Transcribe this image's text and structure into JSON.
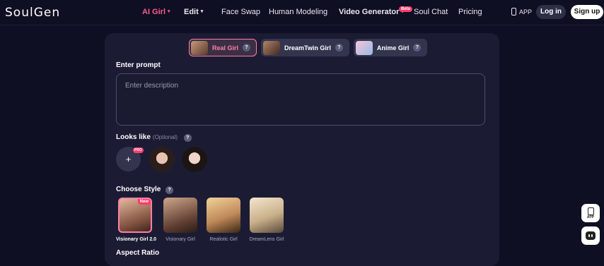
{
  "header": {
    "logo": "SoulGen",
    "nav": [
      {
        "label": "AI Girl",
        "caret": "▾"
      },
      {
        "label": "Edit",
        "caret": "▾"
      },
      {
        "label": "Face Swap"
      },
      {
        "label": "Human Modeling"
      },
      {
        "label": "Video Generator",
        "caret": "▾",
        "badge": "Beta"
      },
      {
        "label": "Soul Chat"
      },
      {
        "label": "Pricing"
      }
    ],
    "app_label": "APP",
    "login_label": "Log in",
    "signup_label": "Sign up"
  },
  "tabs": [
    {
      "label": "Real Girl",
      "help": "?",
      "active": true
    },
    {
      "label": "DreamTwin Girl",
      "help": "?"
    },
    {
      "label": "Anime Girl",
      "help": "?"
    }
  ],
  "prompt": {
    "title": "Enter prompt",
    "placeholder": "Enter description"
  },
  "looks_like": {
    "title": "Looks like",
    "optional": "(Optional)",
    "help": "?",
    "add_symbol": "+",
    "pro_badge": "PRO"
  },
  "style": {
    "title": "Choose Style",
    "help": "?",
    "items": [
      {
        "name": "Visionary Girl 2.0",
        "badge": "New",
        "active": true
      },
      {
        "name": "Visionary Girl"
      },
      {
        "name": "Realistic Girl"
      },
      {
        "name": "DreamLens Girl"
      }
    ]
  },
  "aspect_ratio": {
    "title": "Aspect Ratio"
  },
  "floating": {
    "app_label": "APP"
  },
  "colors": {
    "accent": "#ff5a8a",
    "background": "#0e0f22",
    "panel": "#1b1c34"
  }
}
